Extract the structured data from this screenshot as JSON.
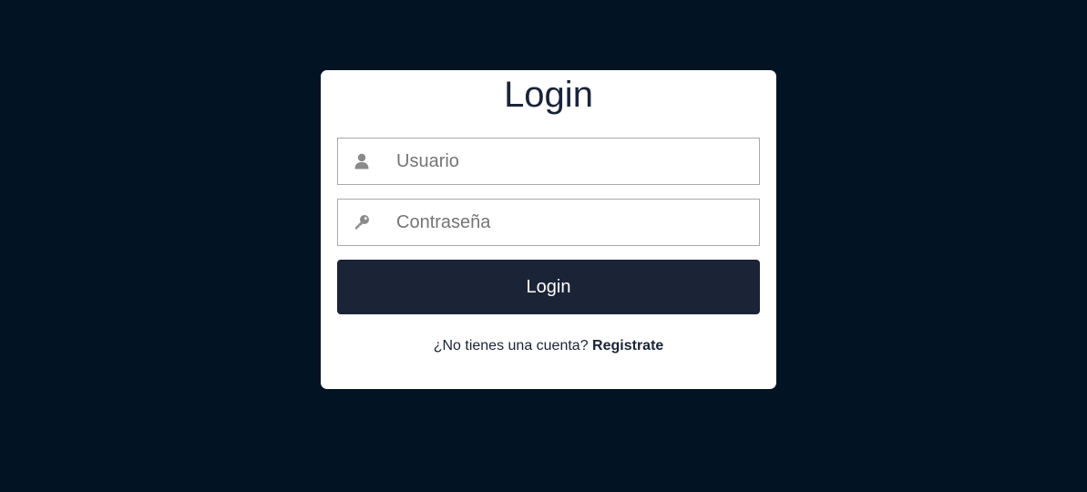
{
  "login": {
    "title": "Login",
    "username": {
      "placeholder": "Usuario",
      "icon": "user-icon"
    },
    "password": {
      "placeholder": "Contraseña",
      "icon": "key-icon"
    },
    "submit_label": "Login",
    "signup_prompt": "¿No tienes una cuenta?",
    "signup_link": "Registrate"
  },
  "colors": {
    "background": "#021324",
    "card": "#ffffff",
    "primary": "#1b2437",
    "icon": "#8a8a8a"
  }
}
